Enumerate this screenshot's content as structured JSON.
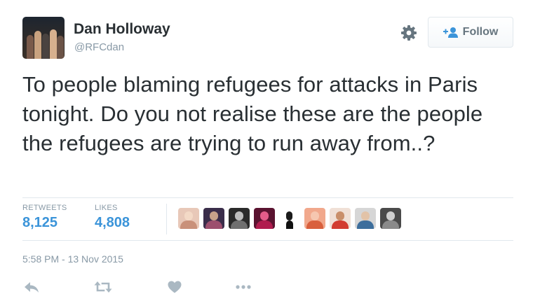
{
  "user": {
    "name": "Dan Holloway",
    "handle": "@RFCdan"
  },
  "follow_button": {
    "label": "Follow",
    "icon": "follow-person-plus-icon"
  },
  "settings_icon": "gear-icon",
  "tweet": {
    "text": "To people blaming refugees for attacks in Paris tonight. Do you not realise these are the people the refugees are trying to run away from..?"
  },
  "stats": {
    "retweets_label": "RETWEETS",
    "retweets_value": "8,125",
    "likes_label": "LIKES",
    "likes_value": "4,808"
  },
  "timestamp": "5:58 PM - 13 Nov 2015",
  "actions": [
    "reply-icon",
    "retweet-icon",
    "like-heart-icon",
    "more-dots-icon"
  ],
  "colors": {
    "text": "#292f33",
    "muted": "#8899a6",
    "accent": "#3b94d9",
    "border": "#e1e8ed",
    "action_icon": "#aab8c2"
  }
}
